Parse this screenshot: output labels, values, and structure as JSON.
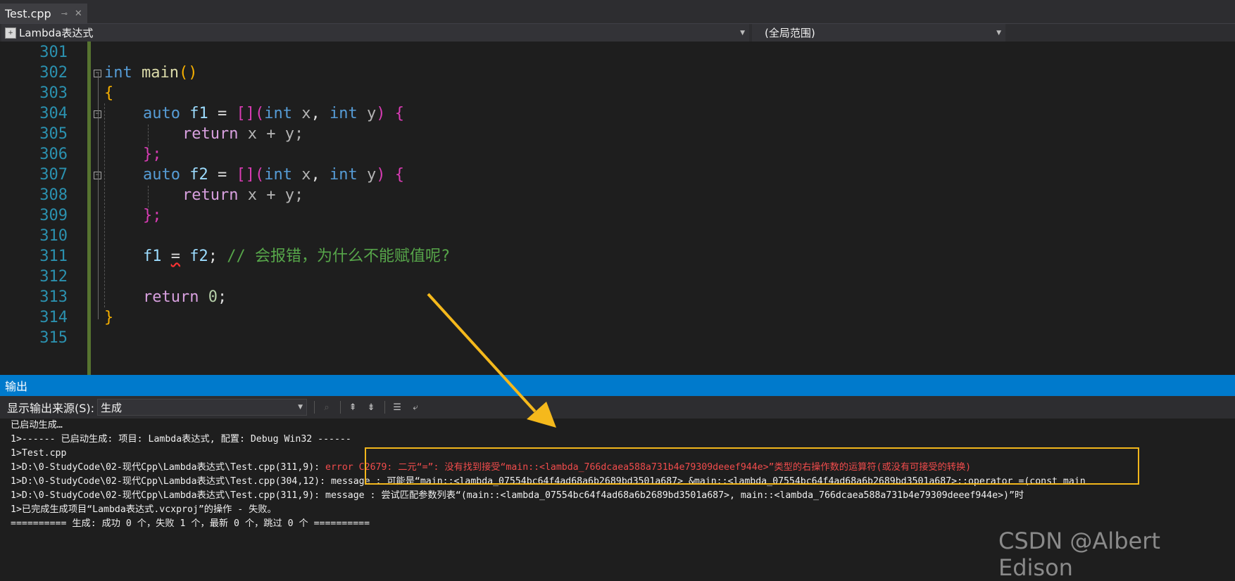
{
  "tab": {
    "title": "Test.cpp",
    "pin": "⊸",
    "close": "✕"
  },
  "nav": {
    "left_label": "Lambda表达式",
    "right_label": "(全局范围)"
  },
  "editor": {
    "lines": [
      {
        "num": "301"
      },
      {
        "num": "302"
      },
      {
        "num": "303"
      },
      {
        "num": "304"
      },
      {
        "num": "305"
      },
      {
        "num": "306"
      },
      {
        "num": "307"
      },
      {
        "num": "308"
      },
      {
        "num": "309"
      },
      {
        "num": "310"
      },
      {
        "num": "311"
      },
      {
        "num": "312"
      },
      {
        "num": "313"
      },
      {
        "num": "314"
      },
      {
        "num": "315"
      }
    ],
    "tokens": {
      "int": "int",
      "main": "main",
      "parens": "()",
      "open_brace": "{",
      "close_brace": "}",
      "auto": "auto",
      "f1": "f1",
      "f2": "f2",
      "eq": "=",
      "lambda_brackets": "[](",
      "int_x": "int",
      "x": "x",
      "comma": ",",
      "int_y": "int",
      "y": "y",
      "close_paren_brace": ") {",
      "return": "return",
      "x_plus_y": "x + y;",
      "close_lambda": "};",
      "semicolon": ";",
      "comment": "// 会报错，为什么不能赋值呢?",
      "zero": "0"
    }
  },
  "output": {
    "title": "输出",
    "source_label": "显示输出来源(S):",
    "source_value": "生成",
    "lines": [
      "已启动生成…",
      "1>------ 已启动生成: 项目: Lambda表达式, 配置: Debug Win32 ------",
      "1>Test.cpp",
      "1>D:\\0-StudyCode\\02-现代Cpp\\Lambda表达式\\Test.cpp(311,9): ",
      "error C2679: 二元“=”: 没有找到接受“main::<lambda_766dcaea588a731b4e79309deeef944e>”类型的右操作数的运算符(或没有可接受的转换)",
      "1>D:\\0-StudyCode\\02-现代Cpp\\Lambda表达式\\Test.cpp(304,12): message : 可能是“main::<lambda_07554bc64f4ad68a6b2689bd3501a687> &main::<lambda_07554bc64f4ad68a6b2689bd3501a687>::operator =(const main",
      "1>D:\\0-StudyCode\\02-现代Cpp\\Lambda表达式\\Test.cpp(311,9): message : 尝试匹配参数列表“(main::<lambda_07554bc64f4ad68a6b2689bd3501a687>, main::<lambda_766dcaea588a731b4e79309deeef944e>)”时",
      "1>已完成生成项目“Lambda表达式.vcxproj”的操作 - 失败。",
      "========== 生成: 成功 0 个，失败 1 个，最新 0 个，跳过 0 个 =========="
    ]
  },
  "watermark": "CSDN @Albert Edison",
  "colors": {
    "accent": "#007acc",
    "highlight_box": "#f2b61b",
    "error": "#f14c4c",
    "arrow": "#f5b91c"
  }
}
